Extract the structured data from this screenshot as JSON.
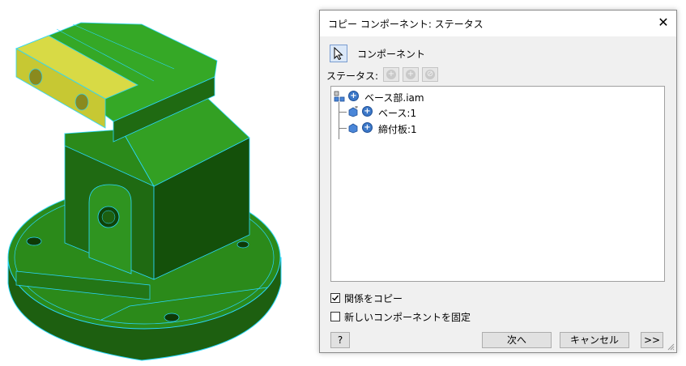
{
  "dialog": {
    "title": "コピー コンポーネント: ステータス",
    "close_glyph": "✕",
    "component_label": "コンポーネント",
    "status_label": "ステータス:",
    "status_buttons": [
      "+",
      "+",
      "⊘"
    ],
    "tree": [
      {
        "label": "ベース部.iam",
        "icon": "assembly-icon",
        "status": "+"
      },
      {
        "label": "ベース:1",
        "icon": "part-icon",
        "status": "+"
      },
      {
        "label": "締付板:1",
        "icon": "part-icon",
        "status": "+"
      }
    ],
    "copy_relations": {
      "label": "関係をコピー",
      "checked": true
    },
    "fix_new_components": {
      "label": "新しいコンポーネントを固定",
      "checked": false
    },
    "help_glyph": "?",
    "next_label": "次へ",
    "cancel_label": "キャンセル",
    "expand_label": ">>"
  },
  "colors": {
    "model_green": "#2e8f1c",
    "model_dark_green": "#1b5a0e",
    "model_edge": "#29d7ff",
    "clamp_yellow": "#c7c833",
    "status_blue": "#3c78c8"
  }
}
